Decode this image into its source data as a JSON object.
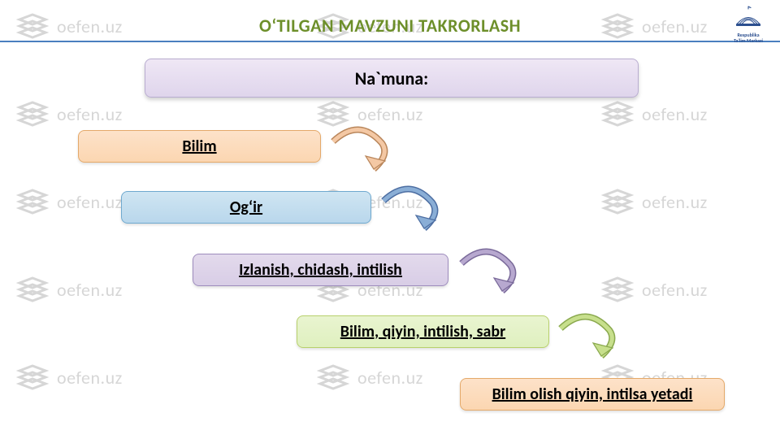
{
  "title": "OʻTILGAN MAVZUNI TAKRORLASH",
  "watermark": "oefen.uz",
  "logo": {
    "line1": "Respublika",
    "line2": "Ta'lim Markazi"
  },
  "boxes": {
    "namuna": "Na`muna:",
    "b1": "Bilim",
    "b2": "Ogʻir",
    "b3": "Izlanish, chidash, intilish",
    "b4": "Bilim, qiyin, intilish, sabr",
    "b5": "Bilim olish qiyin, intilsa yetadi"
  },
  "arrow_colors": {
    "a1": {
      "fill": "#f4c8a4",
      "stroke": "#b9865b"
    },
    "a2": {
      "fill": "#8aaed6",
      "stroke": "#4d6ea2"
    },
    "a3": {
      "fill": "#b7a8cf",
      "stroke": "#7a6a9a"
    },
    "a4": {
      "fill": "#c7df8c",
      "stroke": "#8aa94e"
    }
  }
}
